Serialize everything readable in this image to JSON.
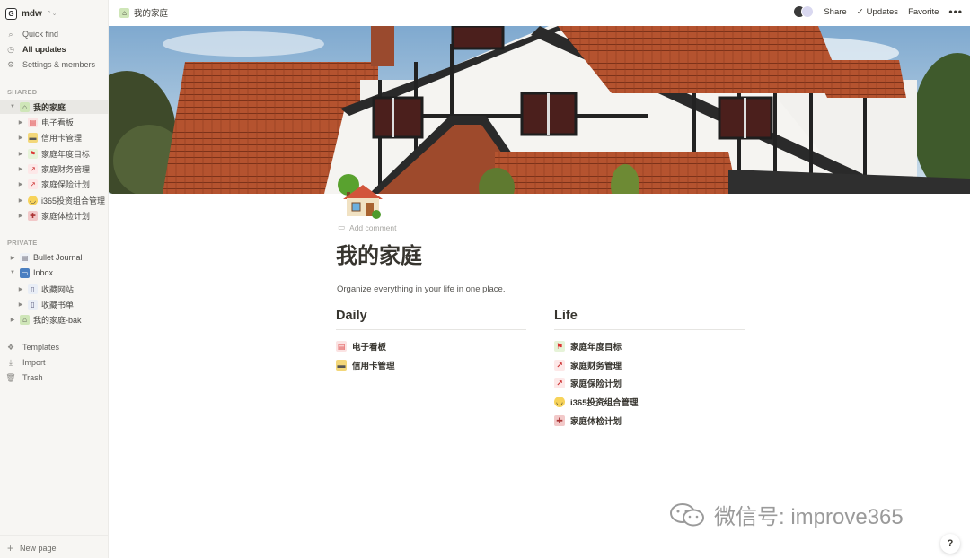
{
  "sidebar": {
    "workspace_name": "mdw",
    "workspace_logo": "G",
    "nav": [
      {
        "label": "Quick find",
        "icon": "search-icon"
      },
      {
        "label": "All updates",
        "icon": "clock-icon"
      },
      {
        "label": "Settings & members",
        "icon": "gear-icon"
      }
    ],
    "shared_label": "SHARED",
    "shared": [
      {
        "label": "我的家庭",
        "expanded": true,
        "level": 0
      },
      {
        "label": "电子看板",
        "level": 1
      },
      {
        "label": "信用卡管理",
        "level": 1
      },
      {
        "label": "家庭年度目标",
        "level": 1
      },
      {
        "label": "家庭财务管理",
        "level": 1
      },
      {
        "label": "家庭保险计划",
        "level": 1
      },
      {
        "label": "i365投资组合管理",
        "level": 1
      },
      {
        "label": "家庭体检计划",
        "level": 1
      }
    ],
    "private_label": "PRIVATE",
    "private": [
      {
        "label": "Bullet Journal",
        "level": 0
      },
      {
        "label": "Inbox",
        "expanded": true,
        "level": 0
      },
      {
        "label": "收藏网站",
        "level": 1
      },
      {
        "label": "收藏书单",
        "level": 1
      },
      {
        "label": "我的家庭-bak",
        "level": 0
      }
    ],
    "bottom": [
      {
        "label": "Templates",
        "icon": "templates-icon"
      },
      {
        "label": "Import",
        "icon": "import-icon"
      },
      {
        "label": "Trash",
        "icon": "trash-icon"
      }
    ],
    "new_page": "New page"
  },
  "topbar": {
    "breadcrumb": "我的家庭",
    "share": "Share",
    "updates": "Updates",
    "favorite": "Favorite",
    "more": "•••"
  },
  "page": {
    "add_comment": "Add comment",
    "title": "我的家庭",
    "description": "Organize everything in your life in one place.",
    "columns": [
      {
        "heading": "Daily",
        "items": [
          "电子看板",
          "信用卡管理"
        ]
      },
      {
        "heading": "Life",
        "items": [
          "家庭年度目标",
          "家庭财务管理",
          "家庭保险计划",
          "i365投资组合管理",
          "家庭体检计划"
        ]
      }
    ]
  },
  "watermark": "微信号: improve365",
  "help": "?"
}
